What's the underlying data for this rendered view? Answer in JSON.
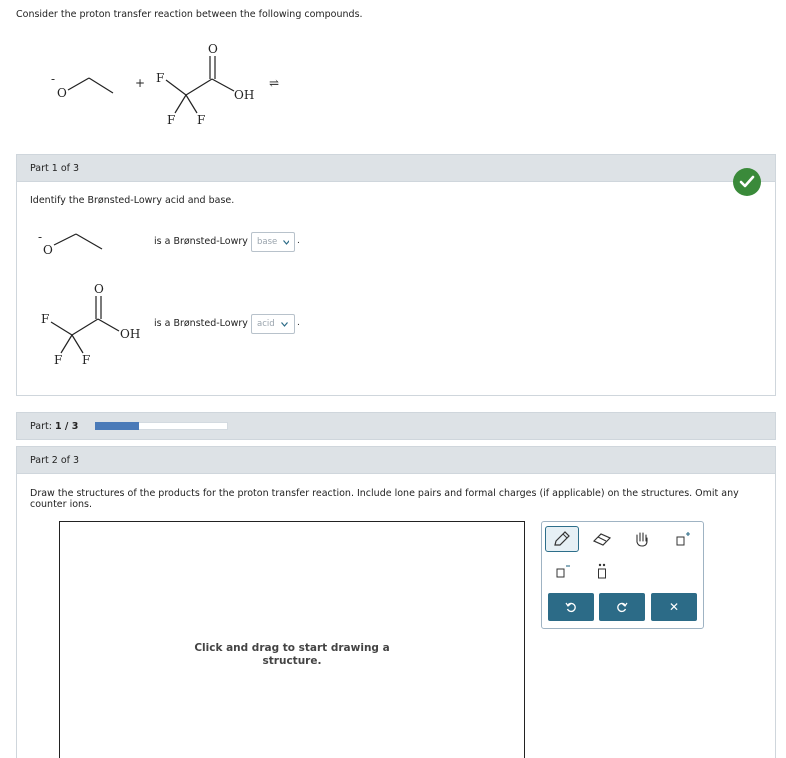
{
  "intro": "Consider the proton transfer reaction between the following compounds.",
  "reaction": {
    "plus": "+",
    "ethoxide": {
      "charge": "-",
      "oxygen": "O"
    },
    "tfa": {
      "carbonyl_o": "O",
      "f1": "F",
      "f2": "F",
      "f3": "F",
      "oh": "OH"
    },
    "arrow": "⇌"
  },
  "part1": {
    "header": "Part 1 of 3",
    "question": "Identify the Brønsted-Lowry acid and base.",
    "rows": [
      {
        "text": "is a Brønsted-Lowry",
        "selected": "base",
        "end": "."
      },
      {
        "text": "is a Brønsted-Lowry",
        "selected": "acid",
        "end": "."
      }
    ],
    "status": "correct"
  },
  "progress": {
    "label": "Part:",
    "value": "1 / 3",
    "fraction": 0.333
  },
  "part2": {
    "header": "Part 2 of 3",
    "instructions": "Draw the structures of the products for the proton transfer reaction. Include lone pairs and formal charges (if applicable) on the structures. Omit any counter ions.",
    "canvas_hint": "Click and drag to start drawing a structure."
  },
  "toolbox": {
    "tools": [
      "pencil-icon",
      "eraser-icon",
      "hand-icon",
      "positive-charge-icon",
      "negative-charge-icon",
      "lone-pair-icon"
    ],
    "actions": [
      "undo-icon",
      "redo-icon",
      "clear-icon"
    ],
    "clear_symbol": "✕"
  },
  "colors": {
    "accent": "#2c6b87",
    "check": "#3a8a3a",
    "progress": "#4a7ab8",
    "header_bg": "#dde2e6"
  }
}
